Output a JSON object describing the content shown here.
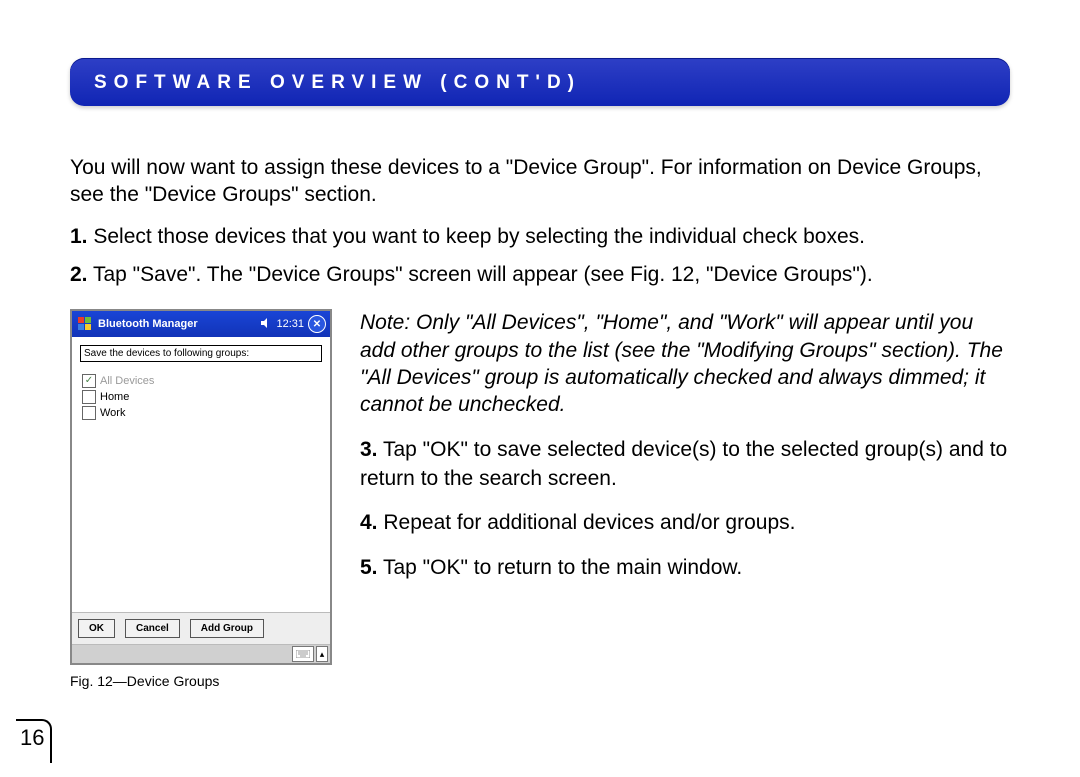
{
  "section_title": "SOFTWARE OVERVIEW (CONT'D)",
  "intro": "You will now want to assign these devices to a \"Device Group\". For information on Device Groups, see the \"Device Groups\" section.",
  "steps_top": [
    {
      "n": "1.",
      "t": "Select those devices that you want to keep by selecting the individual check boxes."
    },
    {
      "n": "2.",
      "t": "Tap \"Save\". The \"Device Groups\" screen will appear (see Fig. 12, \"Device Groups\")."
    }
  ],
  "note": "Note: Only \"All Devices\", \"Home\", and \"Work\" will appear until you add other groups to the list (see the \"Modifying Groups\" section). The \"All Devices\" group is automatically checked and always dimmed; it cannot be unchecked.",
  "steps_cont": [
    {
      "n": "3.",
      "t": "Tap \"OK\" to save selected device(s) to the selected group(s) and to return to the search screen."
    },
    {
      "n": "4.",
      "t": "Repeat for additional devices and/or groups."
    },
    {
      "n": "5.",
      "t": "Tap \"OK\" to return to the main window."
    }
  ],
  "fig": {
    "caption": "Fig. 12—Device Groups",
    "title": "Bluetooth Manager",
    "clock": "12:31",
    "sound_icon": "speaker-icon",
    "save_label": "Save the devices to following groups:",
    "groups": [
      {
        "label": "All Devices",
        "checked": true,
        "dimmed": true
      },
      {
        "label": "Home",
        "checked": false,
        "dimmed": false
      },
      {
        "label": "Work",
        "checked": false,
        "dimmed": false
      }
    ],
    "buttons": {
      "ok": "OK",
      "cancel": "Cancel",
      "add": "Add Group"
    }
  },
  "page_number": "16"
}
